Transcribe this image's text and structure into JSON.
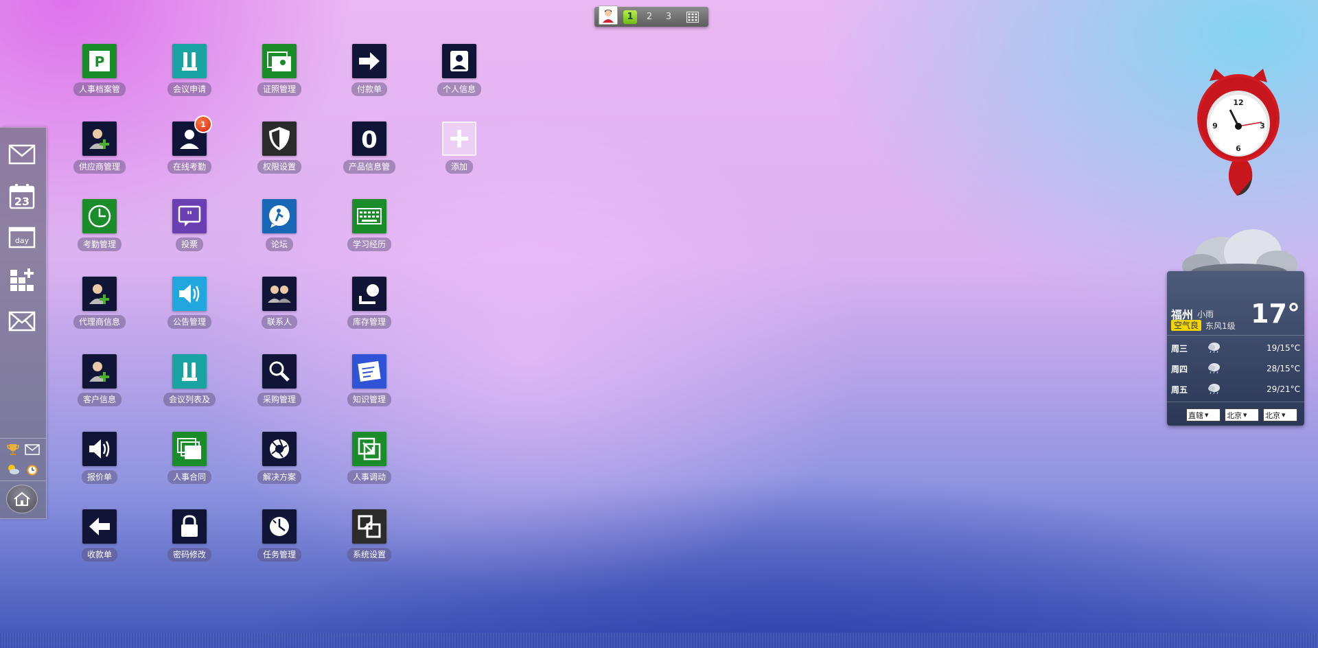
{
  "pager": {
    "pages": [
      "1",
      "2",
      "3"
    ],
    "active_page": "1"
  },
  "apps": [
    {
      "label": "人事档案管",
      "icon": "personnel-file-icon",
      "color": "#1a8c2a"
    },
    {
      "label": "会议申请",
      "icon": "meeting-request-icon",
      "color": "#19a3a3"
    },
    {
      "label": "证照管理",
      "icon": "license-management-icon",
      "color": "#1a8c2a"
    },
    {
      "label": "付款单",
      "icon": "payment-arrow-icon",
      "color": "#101436"
    },
    {
      "label": "个人信息",
      "icon": "personal-info-icon",
      "color": "#101436"
    },
    {
      "label": "供应商管理",
      "icon": "supplier-add-icon",
      "color": "#101436"
    },
    {
      "label": "在线考勤",
      "icon": "online-attendance-icon",
      "color": "#101436",
      "badge": "1"
    },
    {
      "label": "权限设置",
      "icon": "shield-icon",
      "color": "#2b2b2b"
    },
    {
      "label": "产品信息管",
      "icon": "product-info-icon",
      "color": "#101436"
    },
    {
      "label": "添加",
      "icon": "add-icon",
      "color": "add"
    },
    {
      "label": "考勤管理",
      "icon": "clock-icon",
      "color": "#1a8c2a"
    },
    {
      "label": "投票",
      "icon": "vote-quote-icon",
      "color": "#6a3fb2"
    },
    {
      "label": "论坛",
      "icon": "forum-icon",
      "color": "#1867b7"
    },
    {
      "label": "学习经历",
      "icon": "keyboard-icon",
      "color": "#1a8c2a"
    },
    {
      "label": "代理商信息",
      "icon": "agent-add-icon",
      "color": "#101436"
    },
    {
      "label": "公告管理",
      "icon": "speaker-icon",
      "color": "#21a6dd"
    },
    {
      "label": "联系人",
      "icon": "contacts-icon",
      "color": "#101436"
    },
    {
      "label": "库存管理",
      "icon": "inventory-icon",
      "color": "#101436"
    },
    {
      "label": "客户信息",
      "icon": "customer-add-icon",
      "color": "#101436"
    },
    {
      "label": "会议列表及",
      "icon": "meeting-list-icon",
      "color": "#19a3a3"
    },
    {
      "label": "采购管理",
      "icon": "search-icon",
      "color": "#101436"
    },
    {
      "label": "知识管理",
      "icon": "knowledge-icon",
      "color": "#2f52d6"
    },
    {
      "label": "报价单",
      "icon": "quote-speaker-icon",
      "color": "#101436"
    },
    {
      "label": "人事合同",
      "icon": "contract-windows-icon",
      "color": "#1a8c2a"
    },
    {
      "label": "解决方案",
      "icon": "aperture-icon",
      "color": "#101436"
    },
    {
      "label": "人事调动",
      "icon": "transfer-icon",
      "color": "#1a8c2a"
    },
    {
      "label": "收款单",
      "icon": "receipt-arrow-icon",
      "color": "#101436"
    },
    {
      "label": "密码修改",
      "icon": "lock-icon",
      "color": "#101436"
    },
    {
      "label": "任务管理",
      "icon": "task-clock-icon",
      "color": "#101436"
    },
    {
      "label": "系统设置",
      "icon": "system-settings-icon",
      "color": "#2b2b2b"
    }
  ],
  "dock": {
    "items": [
      "mail-icon",
      "calendar-icon",
      "day-view-icon",
      "add-widget-icon",
      "message-icon"
    ],
    "calendar_day": "23",
    "day_text": "day"
  },
  "clock": {
    "numerals": [
      "12",
      "3",
      "6",
      "9"
    ]
  },
  "weather": {
    "city": "福州",
    "condition": "小雨",
    "aqi": "空气良",
    "wind": "东风1级",
    "temp": "17°",
    "forecast": [
      {
        "day": "周三",
        "range": "19/15°C"
      },
      {
        "day": "周四",
        "range": "28/15°C"
      },
      {
        "day": "周五",
        "range": "29/21°C"
      }
    ],
    "selects": [
      "直辖",
      "北京",
      "北京"
    ]
  }
}
